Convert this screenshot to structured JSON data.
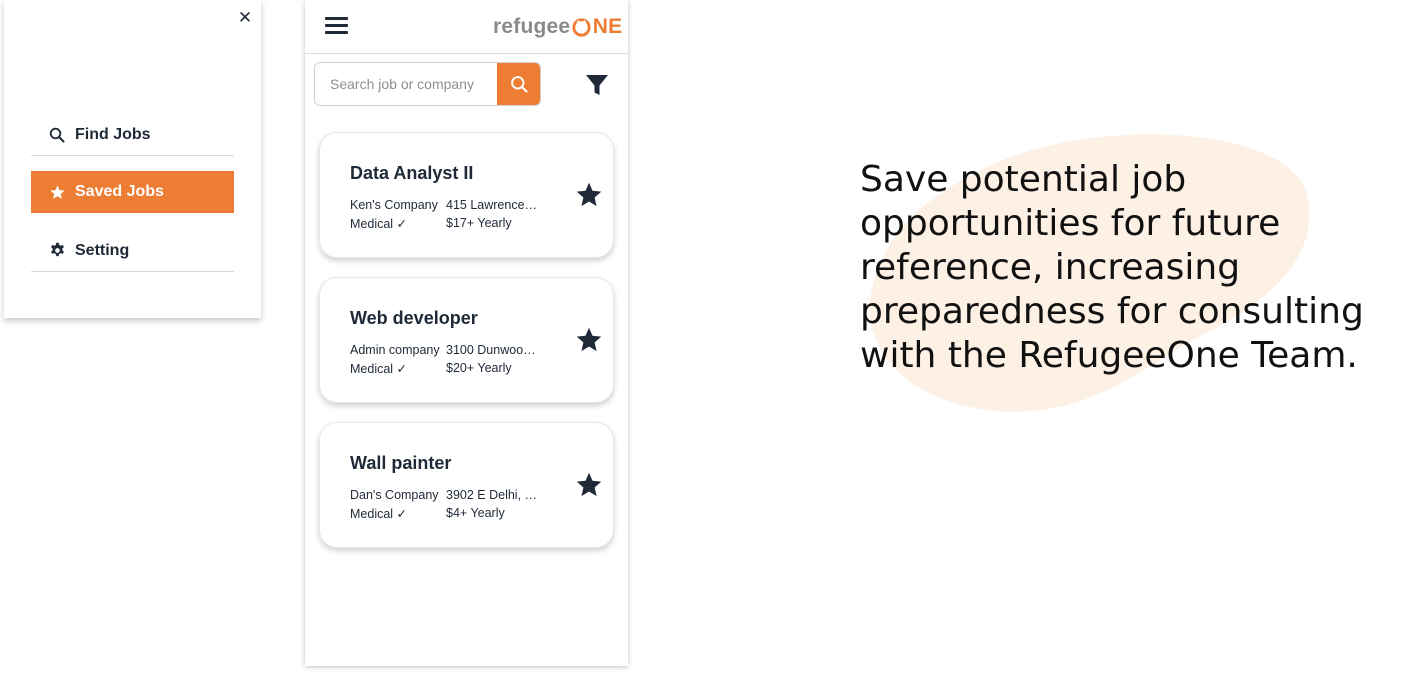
{
  "menu": {
    "close_icon": "close-icon",
    "items": [
      {
        "label": "Find Jobs",
        "icon": "search-icon",
        "active": false
      },
      {
        "label": "Saved Jobs",
        "icon": "star-icon",
        "active": true
      },
      {
        "label": "Setting",
        "icon": "gear-icon",
        "active": false
      }
    ]
  },
  "app": {
    "logo_part1": "refugee",
    "logo_part2": "NE",
    "search_placeholder": "Search job or company",
    "brand_color": "#ec7d33"
  },
  "jobs": [
    {
      "title": "Data Analyst II",
      "company": "Ken's Company",
      "address": "415 Lawrence…",
      "benefit": "Medical ✓",
      "pay": "$17+ Yearly",
      "saved": true
    },
    {
      "title": "Web developer",
      "company": "Admin company",
      "address": "3100 Dunwoo…",
      "benefit": "Medical ✓",
      "pay": "$20+ Yearly",
      "saved": true
    },
    {
      "title": "Wall painter",
      "company": "Dan's Company",
      "address": "3902 E Delhi, …",
      "benefit": "Medical ✓",
      "pay": "$4+ Yearly",
      "saved": true
    }
  ],
  "description": {
    "text": "Save potential job opportunities for future reference, increasing preparedness for consulting with the RefugeeOne Team."
  }
}
